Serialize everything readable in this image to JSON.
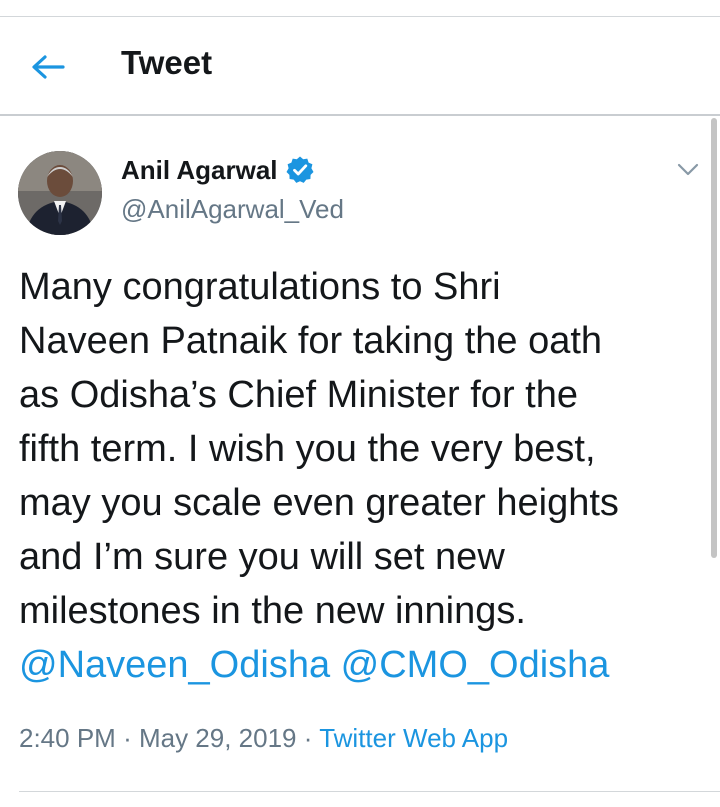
{
  "header": {
    "title": "Tweet"
  },
  "tweet": {
    "author": {
      "name": "Anil Agarwal",
      "handle": "@AnilAgarwal_Ved",
      "verified": true
    },
    "text_lines": [
      "Many congratulations to Shri",
      "Naveen Patnaik for taking the oath",
      "as Odisha’s Chief Minister for the",
      "fifth term. I wish you the very best,",
      "may you scale even greater heights",
      "and I’m sure you will set new",
      "milestones in the new innings."
    ],
    "mentions": [
      "@Naveen_Odisha",
      "@CMO_Odisha"
    ],
    "time": "2:40 PM",
    "separator": "·",
    "date": "May 29, 2019",
    "source": "Twitter Web App"
  },
  "colors": {
    "accent": "#1b95e0",
    "text": "#14171a",
    "muted": "#657786",
    "divider": "#c9cdd1"
  },
  "icons": {
    "back": "arrow-left-icon",
    "verified": "verified-badge-icon",
    "more": "chevron-down-icon"
  }
}
